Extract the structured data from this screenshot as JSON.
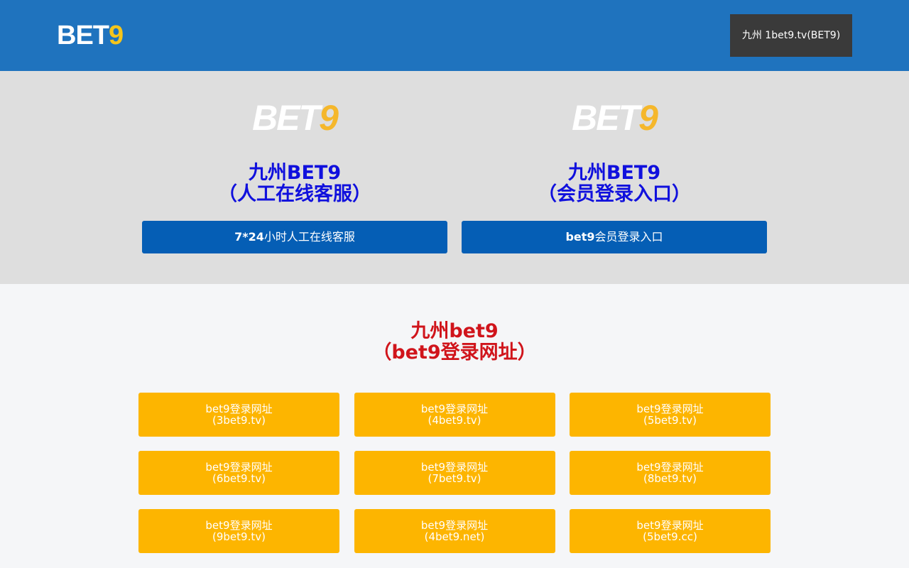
{
  "header": {
    "logo_text_a": "BET",
    "logo_text_b": "9",
    "top_button": "九州 1bet9.tv(BET9)"
  },
  "cards": [
    {
      "logo_a": "BET",
      "logo_b": "9",
      "title_line1": "九州BET9",
      "title_line2": "（人工在线客服）",
      "button_bold": "7*24",
      "button_rest": "小时人工在线客服"
    },
    {
      "logo_a": "BET",
      "logo_b": "9",
      "title_line1": "九州BET9",
      "title_line2": "（会员登录入口）",
      "button_bold": "bet9",
      "button_rest": "会员登录入口"
    }
  ],
  "section": {
    "title_line1": "九州bet9",
    "title_line2": "（bet9登录网址）"
  },
  "links": [
    {
      "label": "bet9登录网址",
      "sub": "(3bet9.tv)"
    },
    {
      "label": "bet9登录网址",
      "sub": "(4bet9.tv)"
    },
    {
      "label": "bet9登录网址",
      "sub": "(5bet9.tv)"
    },
    {
      "label": "bet9登录网址",
      "sub": "(6bet9.tv)"
    },
    {
      "label": "bet9登录网址",
      "sub": "(7bet9.tv)"
    },
    {
      "label": "bet9登录网址",
      "sub": "(8bet9.tv)"
    },
    {
      "label": "bet9登录网址",
      "sub": "(9bet9.tv)"
    },
    {
      "label": "bet9登录网址",
      "sub": "(4bet9.net)"
    },
    {
      "label": "bet9登录网址",
      "sub": "(5bet9.cc)"
    }
  ],
  "colors": {
    "header_bg": "#1f73be",
    "accent_yellow": "#fdb500",
    "button_blue": "#055eb5",
    "title_blue": "#1010dd",
    "title_red": "#d0141b"
  }
}
